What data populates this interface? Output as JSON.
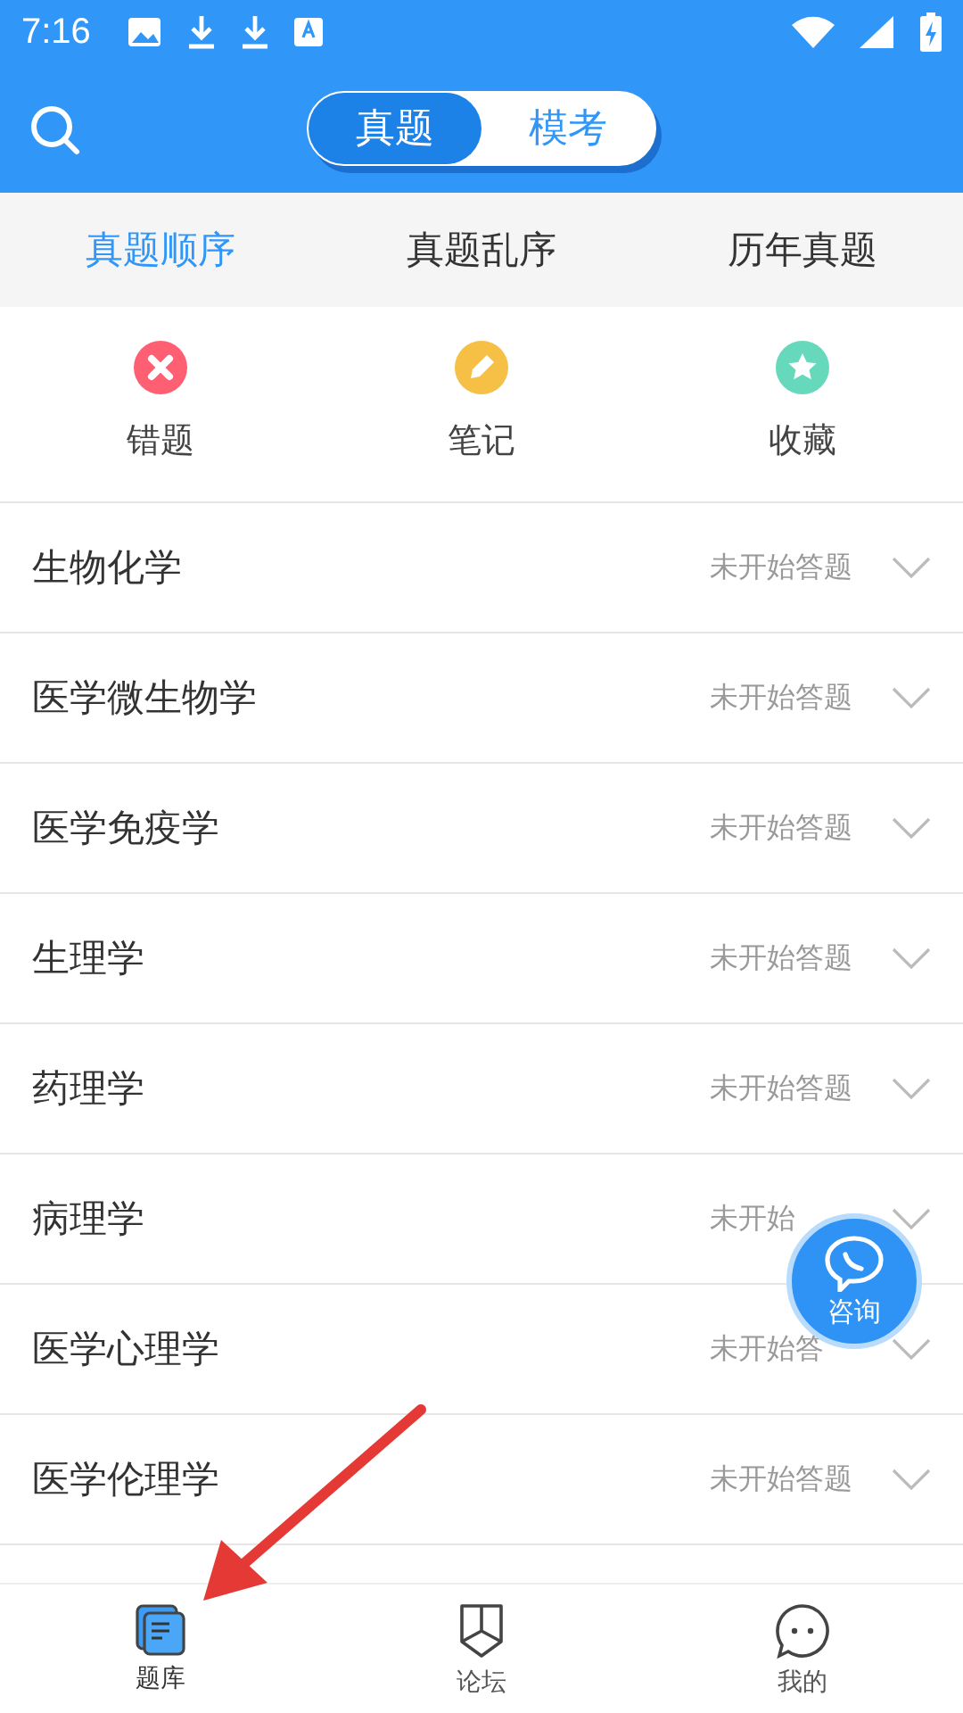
{
  "status_bar": {
    "time": "7:16"
  },
  "mode_tabs": [
    {
      "label": "真题",
      "selected": true
    },
    {
      "label": "模考",
      "selected": false
    }
  ],
  "sub_tabs": [
    {
      "label": "真题顺序",
      "selected": true
    },
    {
      "label": "真题乱序",
      "selected": false
    },
    {
      "label": "历年真题",
      "selected": false
    }
  ],
  "shortcuts": [
    {
      "kind": "wrong",
      "label": "错题",
      "color": "#fe5f72"
    },
    {
      "kind": "notes",
      "label": "笔记",
      "color": "#f6bf46"
    },
    {
      "kind": "favorites",
      "label": "收藏",
      "color": "#66d8bb"
    }
  ],
  "subjects": [
    {
      "name": "生物化学",
      "status": "未开始答题"
    },
    {
      "name": "医学微生物学",
      "status": "未开始答题"
    },
    {
      "name": "医学免疫学",
      "status": "未开始答题"
    },
    {
      "name": "生理学",
      "status": "未开始答题"
    },
    {
      "name": "药理学",
      "status": "未开始答题"
    },
    {
      "name": "病理学",
      "status": "未开始"
    },
    {
      "name": "医学心理学",
      "status": "未开始答"
    },
    {
      "name": "医学伦理学",
      "status": "未开始答题"
    }
  ],
  "consult_button": {
    "label": "咨询"
  },
  "bottom_nav": [
    {
      "kind": "bank",
      "label": "题库",
      "selected": true
    },
    {
      "kind": "forum",
      "label": "论坛",
      "selected": false
    },
    {
      "kind": "me",
      "label": "我的",
      "selected": false
    }
  ]
}
